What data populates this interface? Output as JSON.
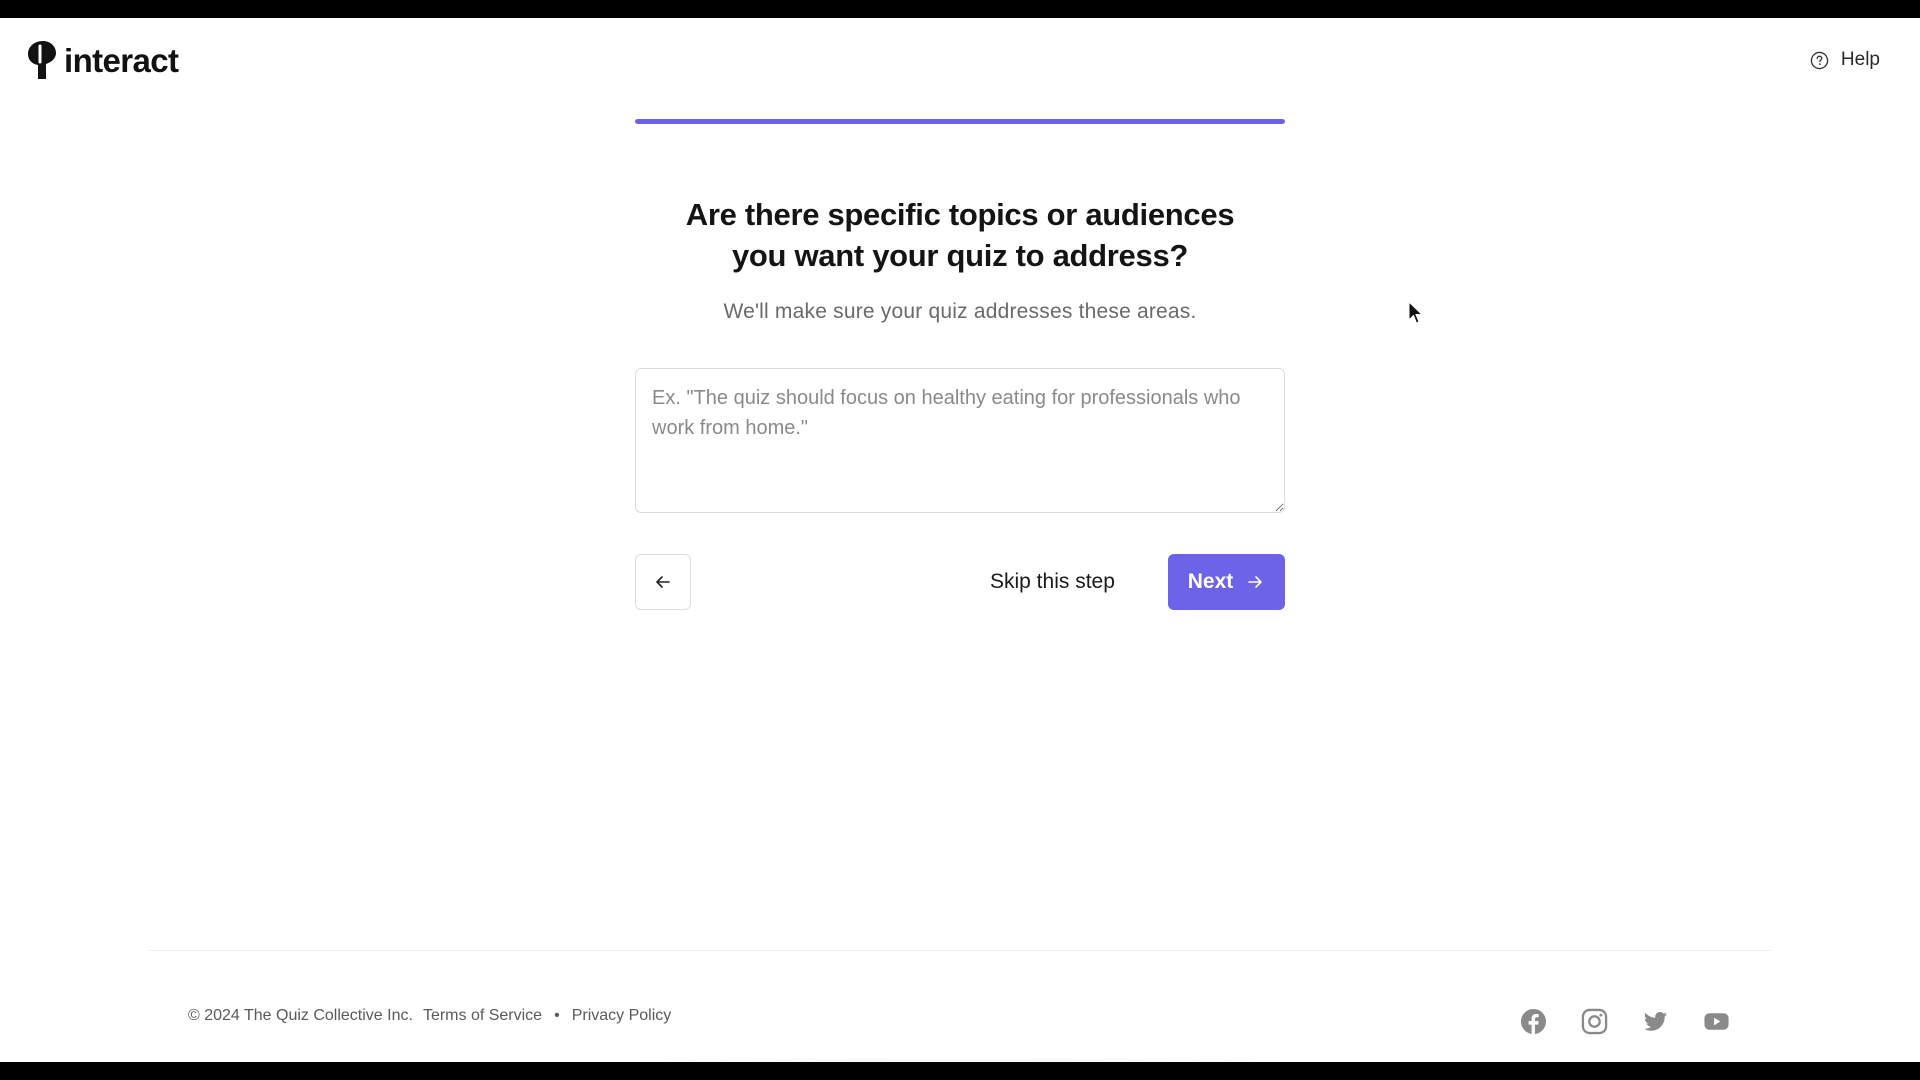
{
  "brand": {
    "name": "interact",
    "accent_color": "#6d63e8",
    "logo_icon": "interact-logo-icon"
  },
  "header": {
    "help_label": "Help",
    "help_icon": "question-circle-icon"
  },
  "progress": {
    "fraction": 1.0
  },
  "question": {
    "title_line1": "Are there specific topics or audiences",
    "title_line2": "you want your quiz to address?",
    "subtitle": "We'll make sure your quiz addresses these areas.",
    "answer_value": "",
    "answer_placeholder": "Ex. \"The quiz should focus on healthy eating for professionals who work from home.\""
  },
  "navigation": {
    "back_icon": "arrow-left-icon",
    "skip_label": "Skip this step",
    "next_label": "Next",
    "next_icon": "arrow-right-icon"
  },
  "footer": {
    "copyright": "© 2024 The Quiz Collective Inc.",
    "terms_label": "Terms of Service",
    "separator": "•",
    "privacy_label": "Privacy Policy",
    "social": [
      "facebook-icon",
      "instagram-icon",
      "twitter-icon",
      "youtube-icon"
    ]
  }
}
